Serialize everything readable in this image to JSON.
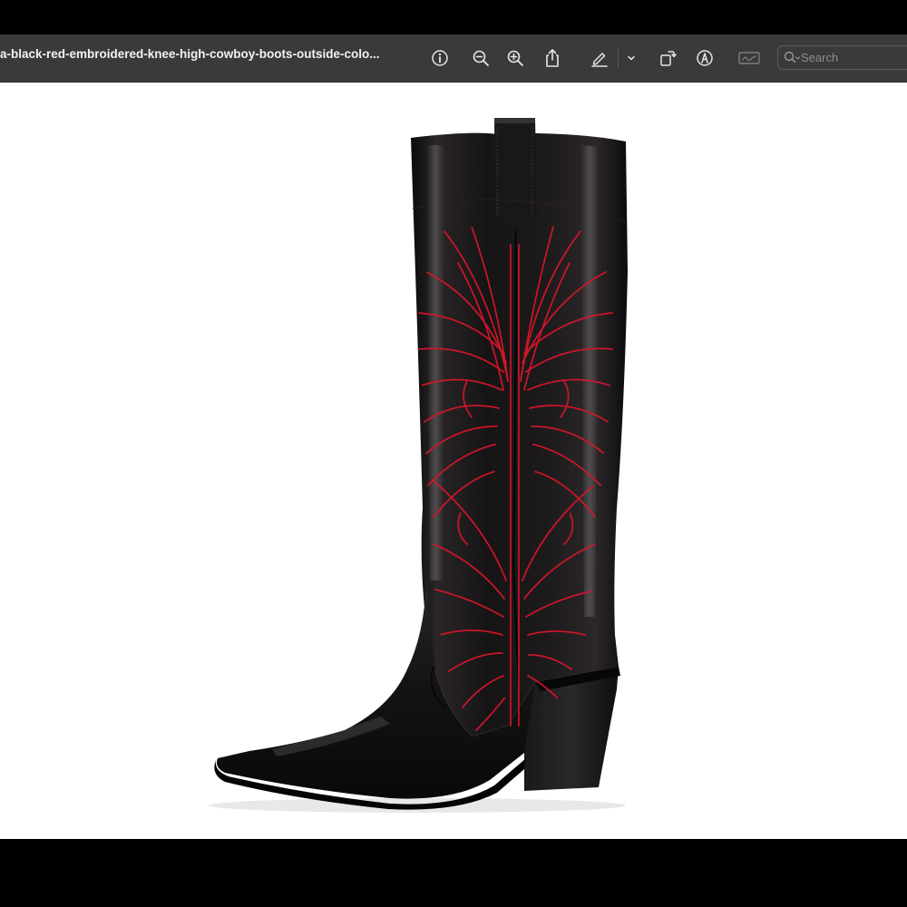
{
  "window": {
    "title": "a-black-red-embroidered-knee-high-cowboy-boots-outside-colo..."
  },
  "toolbar": {
    "buttons": [
      {
        "name": "info-icon"
      },
      {
        "name": "zoom-out-icon"
      },
      {
        "name": "zoom-in-icon"
      },
      {
        "name": "share-icon"
      },
      {
        "name": "highlight-pen-icon"
      },
      {
        "name": "chevron-down-icon"
      },
      {
        "name": "rotate-icon"
      },
      {
        "name": "markup-icon"
      },
      {
        "name": "signature-icon"
      }
    ],
    "search": {
      "placeholder": "Search"
    }
  },
  "colors": {
    "toolbar": "#3a3a3c",
    "bezel": "#000000",
    "canvas": "#ffffff",
    "boot_leather": "#141213",
    "embroidery": "#d8162a"
  }
}
